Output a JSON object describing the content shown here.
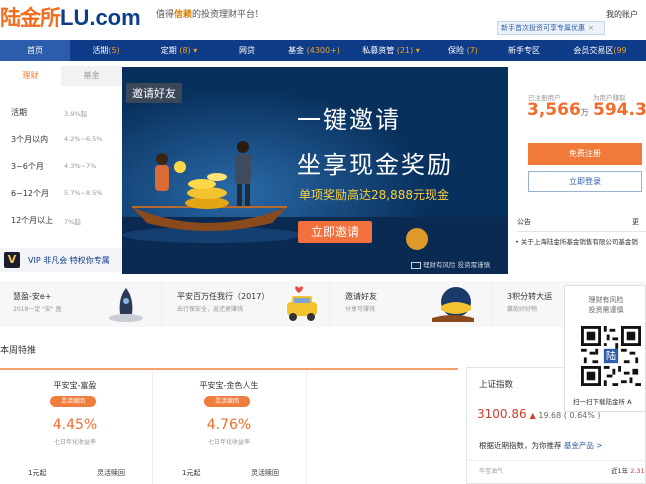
{
  "header": {
    "logo_cn": "陆金所",
    "logo_en": "LU",
    "logo_dot": ".com",
    "slogan_prefix": "值得",
    "slogan_highlight": "信赖",
    "slogan_suffix": "的投资理财平台!",
    "my_account": "我的账户",
    "promo_text": "新手首次投资可享专属优惠",
    "promo_close": "×"
  },
  "nav": [
    {
      "label": "首页",
      "count": ""
    },
    {
      "label": "活期",
      "count": "(5)"
    },
    {
      "label": "定期",
      "count": "(8) ▾"
    },
    {
      "label": "网贷",
      "count": ""
    },
    {
      "label": "基金",
      "count": "(4300+)"
    },
    {
      "label": "私募资管",
      "count": "(21) ▾"
    },
    {
      "label": "保险",
      "count": "(7)"
    },
    {
      "label": "新手专区",
      "count": ""
    },
    {
      "label": "会员交易区",
      "count": "(99"
    }
  ],
  "sidebar": {
    "tabs": [
      "理财",
      "基金"
    ],
    "rows": [
      {
        "term": "活期",
        "rate": "3.9%起"
      },
      {
        "term": "3个月以内",
        "rate": "4.2%~6.5%"
      },
      {
        "term": "3~6个月",
        "rate": "4.3%~7%"
      },
      {
        "term": "6~12个月",
        "rate": "5.7%~8.5%"
      },
      {
        "term": "12个月以上",
        "rate": "7%起"
      }
    ],
    "vip_badge": "V",
    "vip_text": "VIP 非凡会  特权你专属"
  },
  "banner": {
    "tag": "邀请好友",
    "line1": "一键邀请",
    "line2": "坐享现金奖励",
    "line3": "单项奖励高达28,888元现金",
    "button": "立即邀请",
    "footer": "理财有风险  投资需谨慎"
  },
  "right_panel": {
    "registered_label": "已注册用户",
    "registered_value": "3,566",
    "registered_unit": "万",
    "earned_label": "为用户赚取",
    "earned_value": "594.3",
    "register_button": "免费注册",
    "login_button": "立即登录",
    "notice_title": "公告",
    "notice_more": "更",
    "notice_item": "• 关于上海陆金所基金销售有限公司基金销"
  },
  "cards": [
    {
      "title": "慧盈-安e+",
      "sub": "2018一定 \"安\" 盈"
    },
    {
      "title": "平安百万任我行（2017）",
      "sub": "出行保安全，返还更赚钱"
    },
    {
      "title": "邀请好友",
      "sub": "分享可赚钱"
    },
    {
      "title": "3积分转大运",
      "sub": "赢取好好物"
    }
  ],
  "weekly": {
    "title": "本周特推",
    "products": [
      {
        "name": "平安宝-富盈",
        "badge": "灵活赎回",
        "rate": "4.45%",
        "rate_label": "七日年化收益率",
        "min": "1元起",
        "term": "灵活赎回"
      },
      {
        "name": "平安宝-金色人生",
        "badge": "灵活赎回",
        "rate": "4.76%",
        "rate_label": "七日年化收益率",
        "min": "1元起",
        "term": "灵活赎回"
      }
    ]
  },
  "index_panel": {
    "title": "上证指数",
    "value": "3100.86",
    "arrow": "▲",
    "change": "19.68",
    "percent": "( 0.64% )",
    "recommend": "根据近期指数，为你推荐",
    "link": "基金产品 >",
    "foot_left": "华宝油气",
    "foot_right_label": "近1年",
    "foot_right_value": "2.31"
  },
  "qr_widget": {
    "line1": "理财有风险",
    "line2": "投资需谨慎",
    "logo_char": "陆",
    "caption": "扫一扫下载陆金所 A"
  },
  "colors": {
    "brand_navy": "#0f3c89",
    "accent_orange": "#f26c2b",
    "banner_bg": "#08305c",
    "gold": "#ffcf3a"
  }
}
